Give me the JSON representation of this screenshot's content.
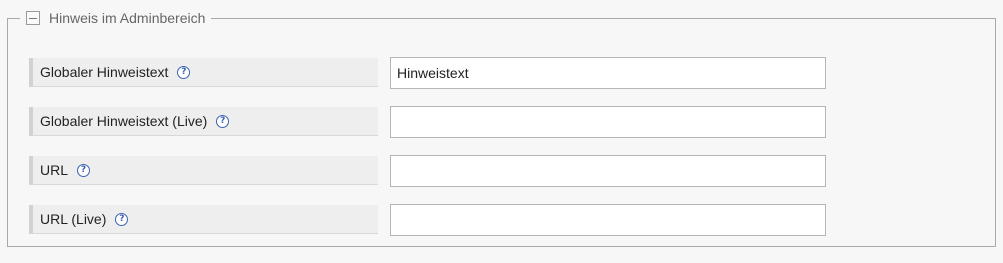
{
  "fieldset": {
    "legend": "Hinweis im Adminbereich",
    "collapsed": false
  },
  "fields": [
    {
      "label": "Globaler Hinweistext",
      "value": "Hinweistext",
      "help_icon": "question-circle-icon"
    },
    {
      "label": "Globaler Hinweistext (Live)",
      "value": "",
      "help_icon": "question-circle-icon"
    },
    {
      "label": "URL",
      "value": "",
      "help_icon": "question-circle-icon"
    },
    {
      "label": "URL (Live)",
      "value": "",
      "help_icon": "question-circle-icon"
    }
  ],
  "colors": {
    "help_icon": "#3b62b3",
    "label_bg": "#eeeeee",
    "page_bg": "#f7f7f7"
  }
}
